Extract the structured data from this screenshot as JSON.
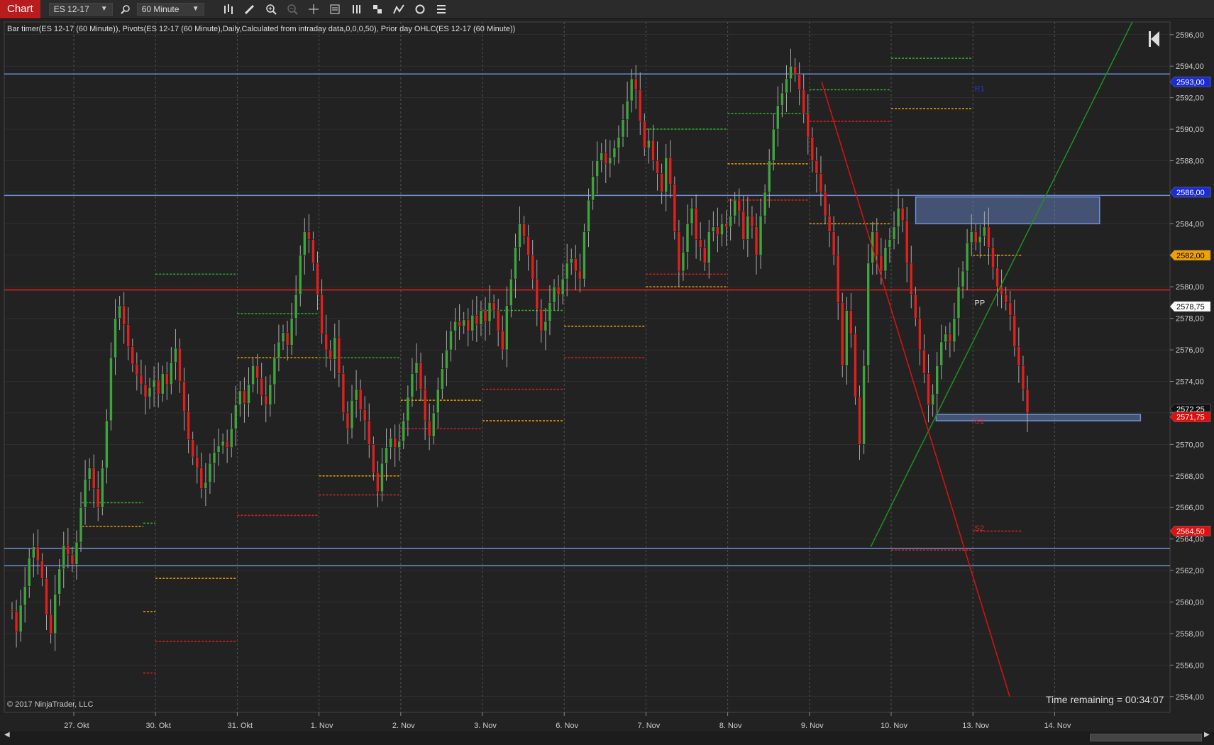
{
  "toolbar": {
    "chart_tab": "Chart",
    "instrument": "ES 12-17",
    "interval": "60 Minute",
    "icons": [
      "search-icon",
      "bar-type-icon",
      "pencil-draw-icon",
      "zoom-in-icon",
      "zoom-out-icon",
      "crosshair-icon",
      "data-box-icon",
      "bars-right-icon",
      "strategies-icon",
      "indicators-icon",
      "refresh-icon",
      "properties-list-icon"
    ]
  },
  "indicator_text": "Bar timer(ES 12-17 (60 Minute)), Pivots(ES 12-17 (60 Minute),Daily,Calculated from intraday data,0,0,0,50), Prior day OHLC(ES 12-17 (60 Minute))",
  "copyright": "© 2017 NinjaTrader, LLC",
  "time_remaining": "Time remaining = 00:34:07",
  "pivot_labels": {
    "pp": "PP",
    "r1": "R1",
    "s1": "S1",
    "s2": "S2"
  },
  "colors": {
    "background": "#222222",
    "grid": "#505050",
    "up_candle": "#3fa33f",
    "down_candle": "#e02020",
    "hline_blue": "#6f8fd8",
    "hline_red": "#e02020",
    "pivot_green": "#2fae2f",
    "pivot_orange": "#f0a000",
    "pivot_red": "#e02020",
    "trend_green": "#209020",
    "trend_red": "#e01010",
    "zone_fill": "#6f8fd8"
  },
  "chart_data": {
    "type": "candlestick",
    "instrument": "ES 12-17",
    "interval": "60 Minute",
    "x_tick_labels": [
      "27. Okt",
      "30. Okt",
      "31. Okt",
      "1. Nov",
      "2. Nov",
      "3. Nov",
      "6. Nov",
      "7. Nov",
      "8. Nov",
      "9. Nov",
      "10. Nov",
      "13. Nov",
      "14. Nov"
    ],
    "y_range": [
      2553,
      2596.8
    ],
    "y_ticks": [
      2554,
      2556,
      2558,
      2560,
      2562,
      2564,
      2566,
      2568,
      2570,
      2572,
      2574,
      2576,
      2578,
      2580,
      2582,
      2584,
      2586,
      2588,
      2590,
      2592,
      2594,
      2596
    ],
    "grid": true,
    "price_markers": [
      {
        "value": 2593.0,
        "label": "2593,00",
        "bg": "#1a2bd8",
        "fg": "#ffffff"
      },
      {
        "value": 2586.0,
        "label": "2586,00",
        "bg": "#1a2bd8",
        "fg": "#ffffff"
      },
      {
        "value": 2582.0,
        "label": "2582,00",
        "bg": "#f0a000",
        "fg": "#000000"
      },
      {
        "value": 2578.75,
        "label": "2578,75",
        "bg": "#ffffff",
        "fg": "#000000"
      },
      {
        "value": 2572.25,
        "label": "2572,25",
        "bg": "#111111",
        "fg": "#ffffff"
      },
      {
        "value": 2571.75,
        "label": "2571,75",
        "bg": "#e01010",
        "fg": "#ffffff"
      },
      {
        "value": 2564.5,
        "label": "2564,50",
        "bg": "#e01010",
        "fg": "#ffffff"
      }
    ],
    "horizontal_lines": [
      {
        "value": 2593.5,
        "color": "blue"
      },
      {
        "value": 2585.8,
        "color": "blue"
      },
      {
        "value": 2579.8,
        "color": "red"
      },
      {
        "value": 2563.4,
        "color": "blue"
      },
      {
        "value": 2562.3,
        "color": "blue"
      }
    ],
    "zones": [
      {
        "x_from": 10.3,
        "x_to": 12.55,
        "y_from": 2584.0,
        "y_to": 2585.7
      },
      {
        "x_from": 10.55,
        "x_to": 13.05,
        "y_from": 2571.5,
        "y_to": 2571.9
      }
    ],
    "trend_lines": [
      {
        "color": "green",
        "x1": 9.75,
        "y1": 2563.5,
        "x2": 12.95,
        "y2": 2596.8
      },
      {
        "color": "red",
        "x1": 9.15,
        "y1": 2593.0,
        "x2": 11.45,
        "y2": 2554.0
      }
    ],
    "pivot_segments": [
      {
        "day": 0,
        "x0": 0.1,
        "x1": 0.85,
        "green": 2566.3,
        "orange": 2564.8,
        "red": null
      },
      {
        "day": 1,
        "x0": 0.85,
        "x1": 1.0,
        "green": 2565.0,
        "orange": 2559.4,
        "red": 2555.5
      },
      {
        "day": 2,
        "x0": 1.0,
        "x1": 2.0,
        "green": 2580.8,
        "orange": 2561.5,
        "red": 2557.5
      },
      {
        "day": 3,
        "x0": 2.0,
        "x1": 3.0,
        "green": 2578.3,
        "orange": 2575.5,
        "red": 2565.5
      },
      {
        "day": 4,
        "x0": 3.0,
        "x1": 4.0,
        "green": 2575.5,
        "orange": 2568.0,
        "red": 2566.8
      },
      {
        "day": 5,
        "x0": 4.0,
        "x1": 5.0,
        "green": 2585.8,
        "orange": 2572.8,
        "red": 2571.0
      },
      {
        "day": 6,
        "x0": 5.0,
        "x1": 6.0,
        "green": 2578.5,
        "orange": 2571.5,
        "red": 2573.5
      },
      {
        "day": 7,
        "x0": 6.0,
        "x1": 7.0,
        "green": 2585.8,
        "orange": 2577.5,
        "red": 2575.5
      },
      {
        "day": 8,
        "x0": 7.0,
        "x1": 8.0,
        "green": 2590.0,
        "orange": 2580.0,
        "red": 2580.8
      },
      {
        "day": 9,
        "x0": 8.0,
        "x1": 9.0,
        "green": 2591.0,
        "orange": 2587.8,
        "red": 2585.5
      },
      {
        "day": 10,
        "x0": 9.0,
        "x1": 10.0,
        "green": 2592.5,
        "orange": 2584.0,
        "red": 2590.5
      },
      {
        "day": 11,
        "x0": 10.0,
        "x1": 11.0,
        "green": 2594.5,
        "orange": 2591.3,
        "red": 2563.3
      },
      {
        "day": 12,
        "x0": 11.0,
        "x1": 11.6,
        "green": 2585.8,
        "orange": 2582.0,
        "red": 2564.5
      }
    ],
    "closes": [
      2559.4,
      2558.1,
      2559.8,
      2561.0,
      2562.8,
      2563.5,
      2562.6,
      2561.5,
      2559.2,
      2558.0,
      2560.5,
      2562.1,
      2563.6,
      2563.0,
      2562.4,
      2563.8,
      2566.0,
      2567.8,
      2568.5,
      2567.2,
      2566.0,
      2568.5,
      2571.5,
      2575.5,
      2578.0,
      2578.8,
      2577.6,
      2576.2,
      2575.1,
      2574.4,
      2573.8,
      2573.0,
      2573.6,
      2574.1,
      2573.2,
      2574.5,
      2573.8,
      2575.2,
      2576.1,
      2574.0,
      2572.1,
      2570.3,
      2569.2,
      2568.5,
      2567.2,
      2567.6,
      2568.8,
      2569.5,
      2569.9,
      2570.2,
      2569.8,
      2571.0,
      2572.5,
      2573.4,
      2572.6,
      2573.8,
      2575.0,
      2574.2,
      2573.1,
      2572.5,
      2573.8,
      2575.5,
      2576.5,
      2577.1,
      2576.3,
      2578.0,
      2579.5,
      2582.0,
      2583.5,
      2583.0,
      2581.5,
      2579.5,
      2577.0,
      2576.0,
      2575.4,
      2576.8,
      2574.5,
      2572.0,
      2571.0,
      2572.8,
      2573.5,
      2572.2,
      2571.5,
      2570.0,
      2568.2,
      2567.0,
      2568.8,
      2569.8,
      2570.4,
      2569.8,
      2570.2,
      2571.5,
      2573.0,
      2574.5,
      2575.2,
      2573.5,
      2571.5,
      2570.5,
      2572.0,
      2573.5,
      2574.8,
      2576.0,
      2577.2,
      2577.8,
      2577.5,
      2577.9,
      2577.2,
      2578.2,
      2577.6,
      2578.5,
      2577.8,
      2579.0,
      2578.5,
      2577.2,
      2576.0,
      2578.8,
      2580.5,
      2582.5,
      2584.0,
      2583.2,
      2582.0,
      2580.5,
      2578.6,
      2577.2,
      2577.8,
      2579.0,
      2580.0,
      2579.5,
      2580.5,
      2581.5,
      2581.8,
      2581.0,
      2580.5,
      2583.5,
      2585.5,
      2587.0,
      2588.0,
      2588.5,
      2587.8,
      2588.2,
      2588.8,
      2589.5,
      2590.6,
      2591.8,
      2593.2,
      2592.5,
      2590.5,
      2588.8,
      2589.3,
      2588.0,
      2587.2,
      2586.0,
      2588.2,
      2586.5,
      2583.5,
      2581.0,
      2582.2,
      2584.0,
      2585.0,
      2583.0,
      2582.5,
      2581.5,
      2583.5,
      2583.8,
      2583.3,
      2584.0,
      2583.8,
      2584.5,
      2585.5,
      2584.8,
      2583.0,
      2584.5,
      2583.8,
      2582.0,
      2584.5,
      2586.0,
      2588.0,
      2590.0,
      2591.5,
      2592.3,
      2593.2,
      2594.0,
      2593.5,
      2592.5,
      2591.0,
      2589.5,
      2588.0,
      2587.2,
      2586.0,
      2584.5,
      2583.5,
      2582.0,
      2579.0,
      2575.0,
      2578.5,
      2577.0,
      2573.0,
      2570.0,
      2575.0,
      2581.5,
      2583.5,
      2582.0,
      2581.0,
      2582.5,
      2583.0,
      2583.8,
      2585.0,
      2584.2,
      2581.5,
      2579.5,
      2578.0,
      2576.0,
      2574.5,
      2572.5,
      2573.2,
      2575.0,
      2576.5,
      2577.0,
      2576.5,
      2578.0,
      2580.0,
      2581.0,
      2582.8,
      2583.5,
      2582.8,
      2583.2,
      2583.8,
      2582.5,
      2581.2,
      2580.0,
      2579.5,
      2579.0,
      2578.2,
      2576.2,
      2575.0,
      2573.5,
      2572.0
    ]
  }
}
